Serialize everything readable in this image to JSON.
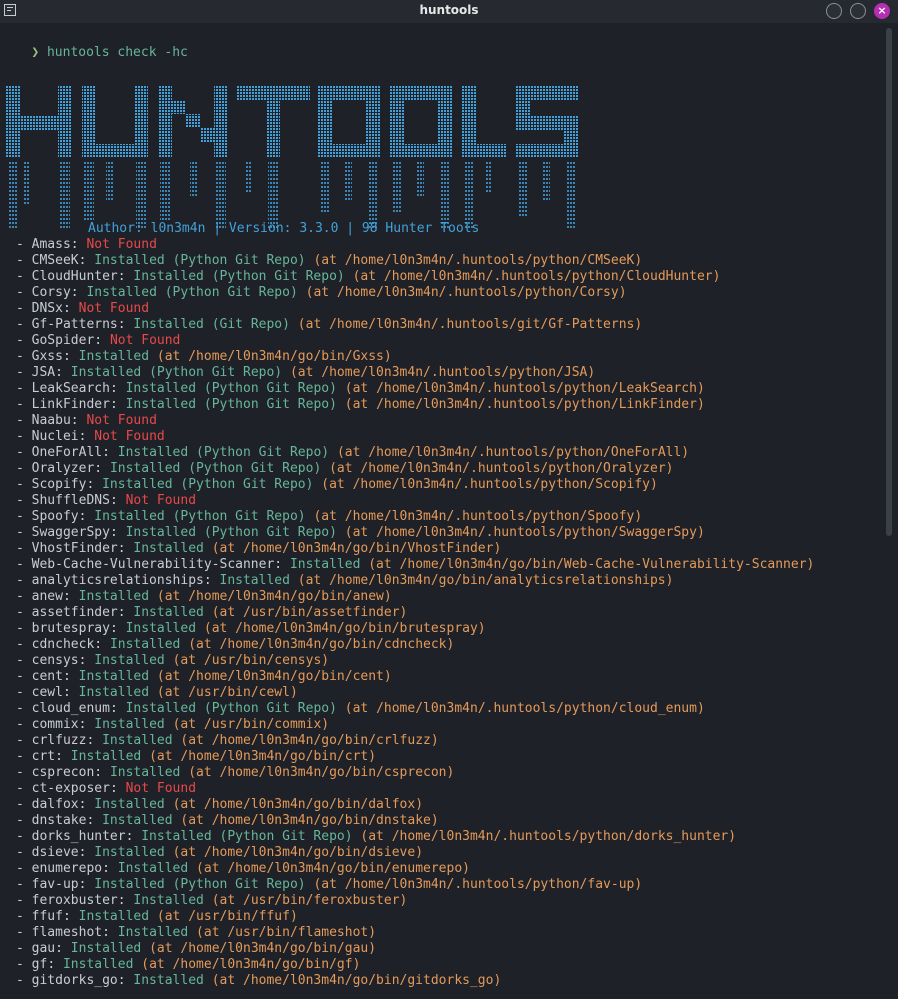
{
  "window": {
    "title": "huntools"
  },
  "command": {
    "prompt": "❯",
    "text": "huntools check -hc"
  },
  "banner": {
    "logo": "HUNTOOLS",
    "info": "Author: l0n3m4n | Version: 3.3.0 | 98 Hunter Tools"
  },
  "colors": {
    "background": "#1e2127",
    "installed": "#67b59a",
    "not_found": "#e8494a",
    "path": "#e39a5b",
    "banner": "#43a1d9"
  },
  "tools": [
    {
      "name": "Amass",
      "status": "Not Found",
      "kind": "",
      "path": ""
    },
    {
      "name": "CMSeeK",
      "status": "Installed",
      "kind": "(Python Git Repo)",
      "path": "(at /home/l0n3m4n/.huntools/python/CMSeeK)"
    },
    {
      "name": "CloudHunter",
      "status": "Installed",
      "kind": "(Python Git Repo)",
      "path": "(at /home/l0n3m4n/.huntools/python/CloudHunter)"
    },
    {
      "name": "Corsy",
      "status": "Installed",
      "kind": "(Python Git Repo)",
      "path": "(at /home/l0n3m4n/.huntools/python/Corsy)"
    },
    {
      "name": "DNSx",
      "status": "Not Found",
      "kind": "",
      "path": ""
    },
    {
      "name": "Gf-Patterns",
      "status": "Installed",
      "kind": "(Git Repo)",
      "path": "(at /home/l0n3m4n/.huntools/git/Gf-Patterns)"
    },
    {
      "name": "GoSpider",
      "status": "Not Found",
      "kind": "",
      "path": ""
    },
    {
      "name": "Gxss",
      "status": "Installed",
      "kind": "",
      "path": "(at /home/l0n3m4n/go/bin/Gxss)"
    },
    {
      "name": "JSA",
      "status": "Installed",
      "kind": "(Python Git Repo)",
      "path": "(at /home/l0n3m4n/.huntools/python/JSA)"
    },
    {
      "name": "LeakSearch",
      "status": "Installed",
      "kind": "(Python Git Repo)",
      "path": "(at /home/l0n3m4n/.huntools/python/LeakSearch)"
    },
    {
      "name": "LinkFinder",
      "status": "Installed",
      "kind": "(Python Git Repo)",
      "path": "(at /home/l0n3m4n/.huntools/python/LinkFinder)"
    },
    {
      "name": "Naabu",
      "status": "Not Found",
      "kind": "",
      "path": ""
    },
    {
      "name": "Nuclei",
      "status": "Not Found",
      "kind": "",
      "path": ""
    },
    {
      "name": "OneForAll",
      "status": "Installed",
      "kind": "(Python Git Repo)",
      "path": "(at /home/l0n3m4n/.huntools/python/OneForAll)"
    },
    {
      "name": "Oralyzer",
      "status": "Installed",
      "kind": "(Python Git Repo)",
      "path": "(at /home/l0n3m4n/.huntools/python/Oralyzer)"
    },
    {
      "name": "Scopify",
      "status": "Installed",
      "kind": "(Python Git Repo)",
      "path": "(at /home/l0n3m4n/.huntools/python/Scopify)"
    },
    {
      "name": "ShuffleDNS",
      "status": "Not Found",
      "kind": "",
      "path": ""
    },
    {
      "name": "Spoofy",
      "status": "Installed",
      "kind": "(Python Git Repo)",
      "path": "(at /home/l0n3m4n/.huntools/python/Spoofy)"
    },
    {
      "name": "SwaggerSpy",
      "status": "Installed",
      "kind": "(Python Git Repo)",
      "path": "(at /home/l0n3m4n/.huntools/python/SwaggerSpy)"
    },
    {
      "name": "VhostFinder",
      "status": "Installed",
      "kind": "",
      "path": "(at /home/l0n3m4n/go/bin/VhostFinder)"
    },
    {
      "name": "Web-Cache-Vulnerability-Scanner",
      "status": "Installed",
      "kind": "",
      "path": "(at /home/l0n3m4n/go/bin/Web-Cache-Vulnerability-Scanner)"
    },
    {
      "name": "analyticsrelationships",
      "status": "Installed",
      "kind": "",
      "path": "(at /home/l0n3m4n/go/bin/analyticsrelationships)"
    },
    {
      "name": "anew",
      "status": "Installed",
      "kind": "",
      "path": "(at /home/l0n3m4n/go/bin/anew)"
    },
    {
      "name": "assetfinder",
      "status": "Installed",
      "kind": "",
      "path": "(at /usr/bin/assetfinder)"
    },
    {
      "name": "brutespray",
      "status": "Installed",
      "kind": "",
      "path": "(at /home/l0n3m4n/go/bin/brutespray)"
    },
    {
      "name": "cdncheck",
      "status": "Installed",
      "kind": "",
      "path": "(at /home/l0n3m4n/go/bin/cdncheck)"
    },
    {
      "name": "censys",
      "status": "Installed",
      "kind": "",
      "path": "(at /usr/bin/censys)"
    },
    {
      "name": "cent",
      "status": "Installed",
      "kind": "",
      "path": "(at /home/l0n3m4n/go/bin/cent)"
    },
    {
      "name": "cewl",
      "status": "Installed",
      "kind": "",
      "path": "(at /usr/bin/cewl)"
    },
    {
      "name": "cloud_enum",
      "status": "Installed",
      "kind": "(Python Git Repo)",
      "path": "(at /home/l0n3m4n/.huntools/python/cloud_enum)"
    },
    {
      "name": "commix",
      "status": "Installed",
      "kind": "",
      "path": "(at /usr/bin/commix)"
    },
    {
      "name": "crlfuzz",
      "status": "Installed",
      "kind": "",
      "path": "(at /home/l0n3m4n/go/bin/crlfuzz)"
    },
    {
      "name": "crt",
      "status": "Installed",
      "kind": "",
      "path": "(at /home/l0n3m4n/go/bin/crt)"
    },
    {
      "name": "csprecon",
      "status": "Installed",
      "kind": "",
      "path": "(at /home/l0n3m4n/go/bin/csprecon)"
    },
    {
      "name": "ct-exposer",
      "status": "Not Found",
      "kind": "",
      "path": ""
    },
    {
      "name": "dalfox",
      "status": "Installed",
      "kind": "",
      "path": "(at /home/l0n3m4n/go/bin/dalfox)"
    },
    {
      "name": "dnstake",
      "status": "Installed",
      "kind": "",
      "path": "(at /home/l0n3m4n/go/bin/dnstake)"
    },
    {
      "name": "dorks_hunter",
      "status": "Installed",
      "kind": "(Python Git Repo)",
      "path": "(at /home/l0n3m4n/.huntools/python/dorks_hunter)"
    },
    {
      "name": "dsieve",
      "status": "Installed",
      "kind": "",
      "path": "(at /home/l0n3m4n/go/bin/dsieve)"
    },
    {
      "name": "enumerepo",
      "status": "Installed",
      "kind": "",
      "path": "(at /home/l0n3m4n/go/bin/enumerepo)"
    },
    {
      "name": "fav-up",
      "status": "Installed",
      "kind": "(Python Git Repo)",
      "path": "(at /home/l0n3m4n/.huntools/python/fav-up)"
    },
    {
      "name": "feroxbuster",
      "status": "Installed",
      "kind": "",
      "path": "(at /usr/bin/feroxbuster)"
    },
    {
      "name": "ffuf",
      "status": "Installed",
      "kind": "",
      "path": "(at /usr/bin/ffuf)"
    },
    {
      "name": "flameshot",
      "status": "Installed",
      "kind": "",
      "path": "(at /usr/bin/flameshot)"
    },
    {
      "name": "gau",
      "status": "Installed",
      "kind": "",
      "path": "(at /home/l0n3m4n/go/bin/gau)"
    },
    {
      "name": "gf",
      "status": "Installed",
      "kind": "",
      "path": "(at /home/l0n3m4n/go/bin/gf)"
    },
    {
      "name": "gitdorks_go",
      "status": "Installed",
      "kind": "",
      "path": "(at /home/l0n3m4n/go/bin/gitdorks_go)"
    }
  ]
}
